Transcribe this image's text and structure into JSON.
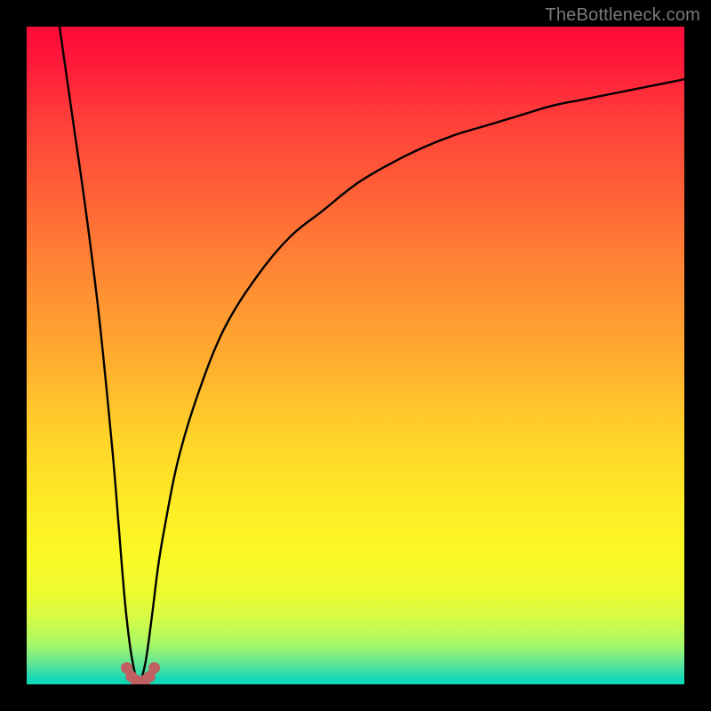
{
  "watermark": {
    "text": "TheBottleneck.com"
  },
  "colors": {
    "frame": "#000000",
    "curve": "#000000",
    "marker": "#c06062",
    "gradient_stops": [
      "#ff0a3a",
      "#ff1c3a",
      "#ff3e3a",
      "#ff6a36",
      "#ff8f33",
      "#ffb12e",
      "#ffd22a",
      "#feea26",
      "#fbf826",
      "#eefb30",
      "#d4fb45",
      "#a6f86a",
      "#5de49a",
      "#19d7b3",
      "#0fd5b7"
    ]
  },
  "chart_data": {
    "type": "line",
    "title": "",
    "xlabel": "",
    "ylabel": "",
    "xlim": [
      0,
      100
    ],
    "ylim": [
      0,
      100
    ],
    "grid": false,
    "legend": false,
    "note": "Bottleneck-style curve: y decreases sharply to ~0 near x≈17 then rises asymptotically toward ~92. Values estimated from pixels; chart has no numeric axes.",
    "series": [
      {
        "name": "bottleneck-curve",
        "x": [
          5,
          7,
          9,
          11,
          13,
          14,
          15,
          16,
          17,
          18,
          19,
          20,
          21,
          23,
          26,
          30,
          35,
          40,
          45,
          50,
          55,
          60,
          65,
          70,
          75,
          80,
          85,
          90,
          95,
          100
        ],
        "y": [
          100,
          86,
          72,
          56,
          36,
          24,
          12,
          4,
          0.5,
          3,
          10,
          18,
          24,
          34,
          44,
          54,
          62,
          68,
          72,
          76,
          79,
          81.5,
          83.5,
          85,
          86.5,
          88,
          89,
          90,
          91,
          92
        ]
      }
    ],
    "markers": {
      "name": "highlight-cluster",
      "note": "Small rounded markers clustered at the curve minimum.",
      "x": [
        15.2,
        15.9,
        16.6,
        17.3,
        18.0,
        18.7,
        19.4
      ],
      "y": [
        2.5,
        1.2,
        0.6,
        0.4,
        0.6,
        1.2,
        2.5
      ]
    }
  }
}
